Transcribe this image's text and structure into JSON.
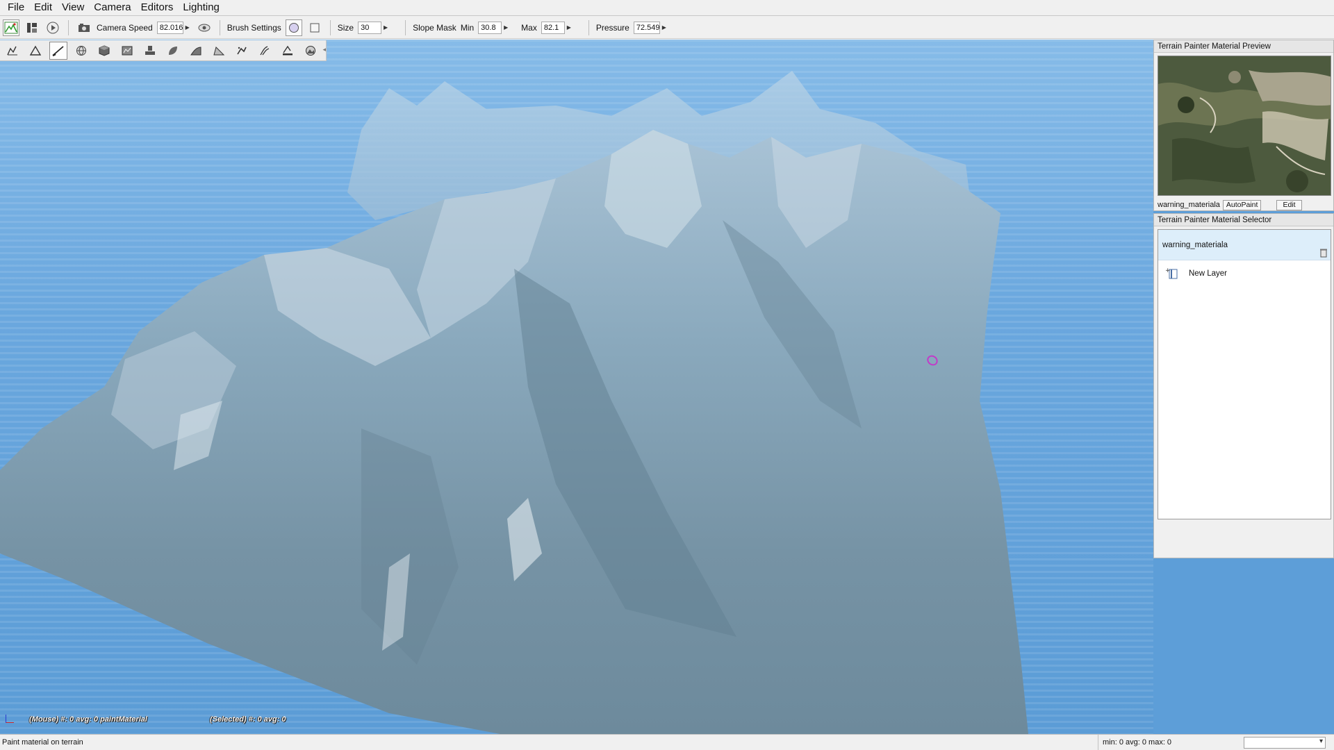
{
  "menubar": {
    "items": [
      "File",
      "Edit",
      "View",
      "Camera",
      "Editors",
      "Lighting"
    ]
  },
  "toolbar": {
    "camera_speed_label": "Camera Speed",
    "camera_speed_value": "82.016",
    "brush_settings_label": "Brush Settings",
    "size_label": "Size",
    "size_value": "30",
    "slope_mask_label": "Slope Mask",
    "min_label": "Min",
    "min_value": "30.8",
    "max_label": "Max",
    "max_value": "82.1",
    "pressure_label": "Pressure",
    "pressure_value": "72.549"
  },
  "viewport": {
    "mouse_info": "(Mouse) #: 0  avg: 0 paintMaterial",
    "selected_info": "(Selected) #: 0  avg: 0"
  },
  "preview_panel": {
    "title": "Terrain Painter Material Preview",
    "material_name": "warning_materiala",
    "autopaint_label": "AutoPaint",
    "edit_label": "Edit"
  },
  "selector_panel": {
    "title": "Terrain Painter Material Selector",
    "material_name": "warning_materiala",
    "new_layer_label": "New Layer"
  },
  "statusbar": {
    "text": "Paint material on terrain",
    "stats": "min: 0  avg: 0  max: 0"
  },
  "colors": {
    "sky": "#6aa7de",
    "brush_cursor": "#c23ac9",
    "selection_highlight": "#ddeefa"
  }
}
